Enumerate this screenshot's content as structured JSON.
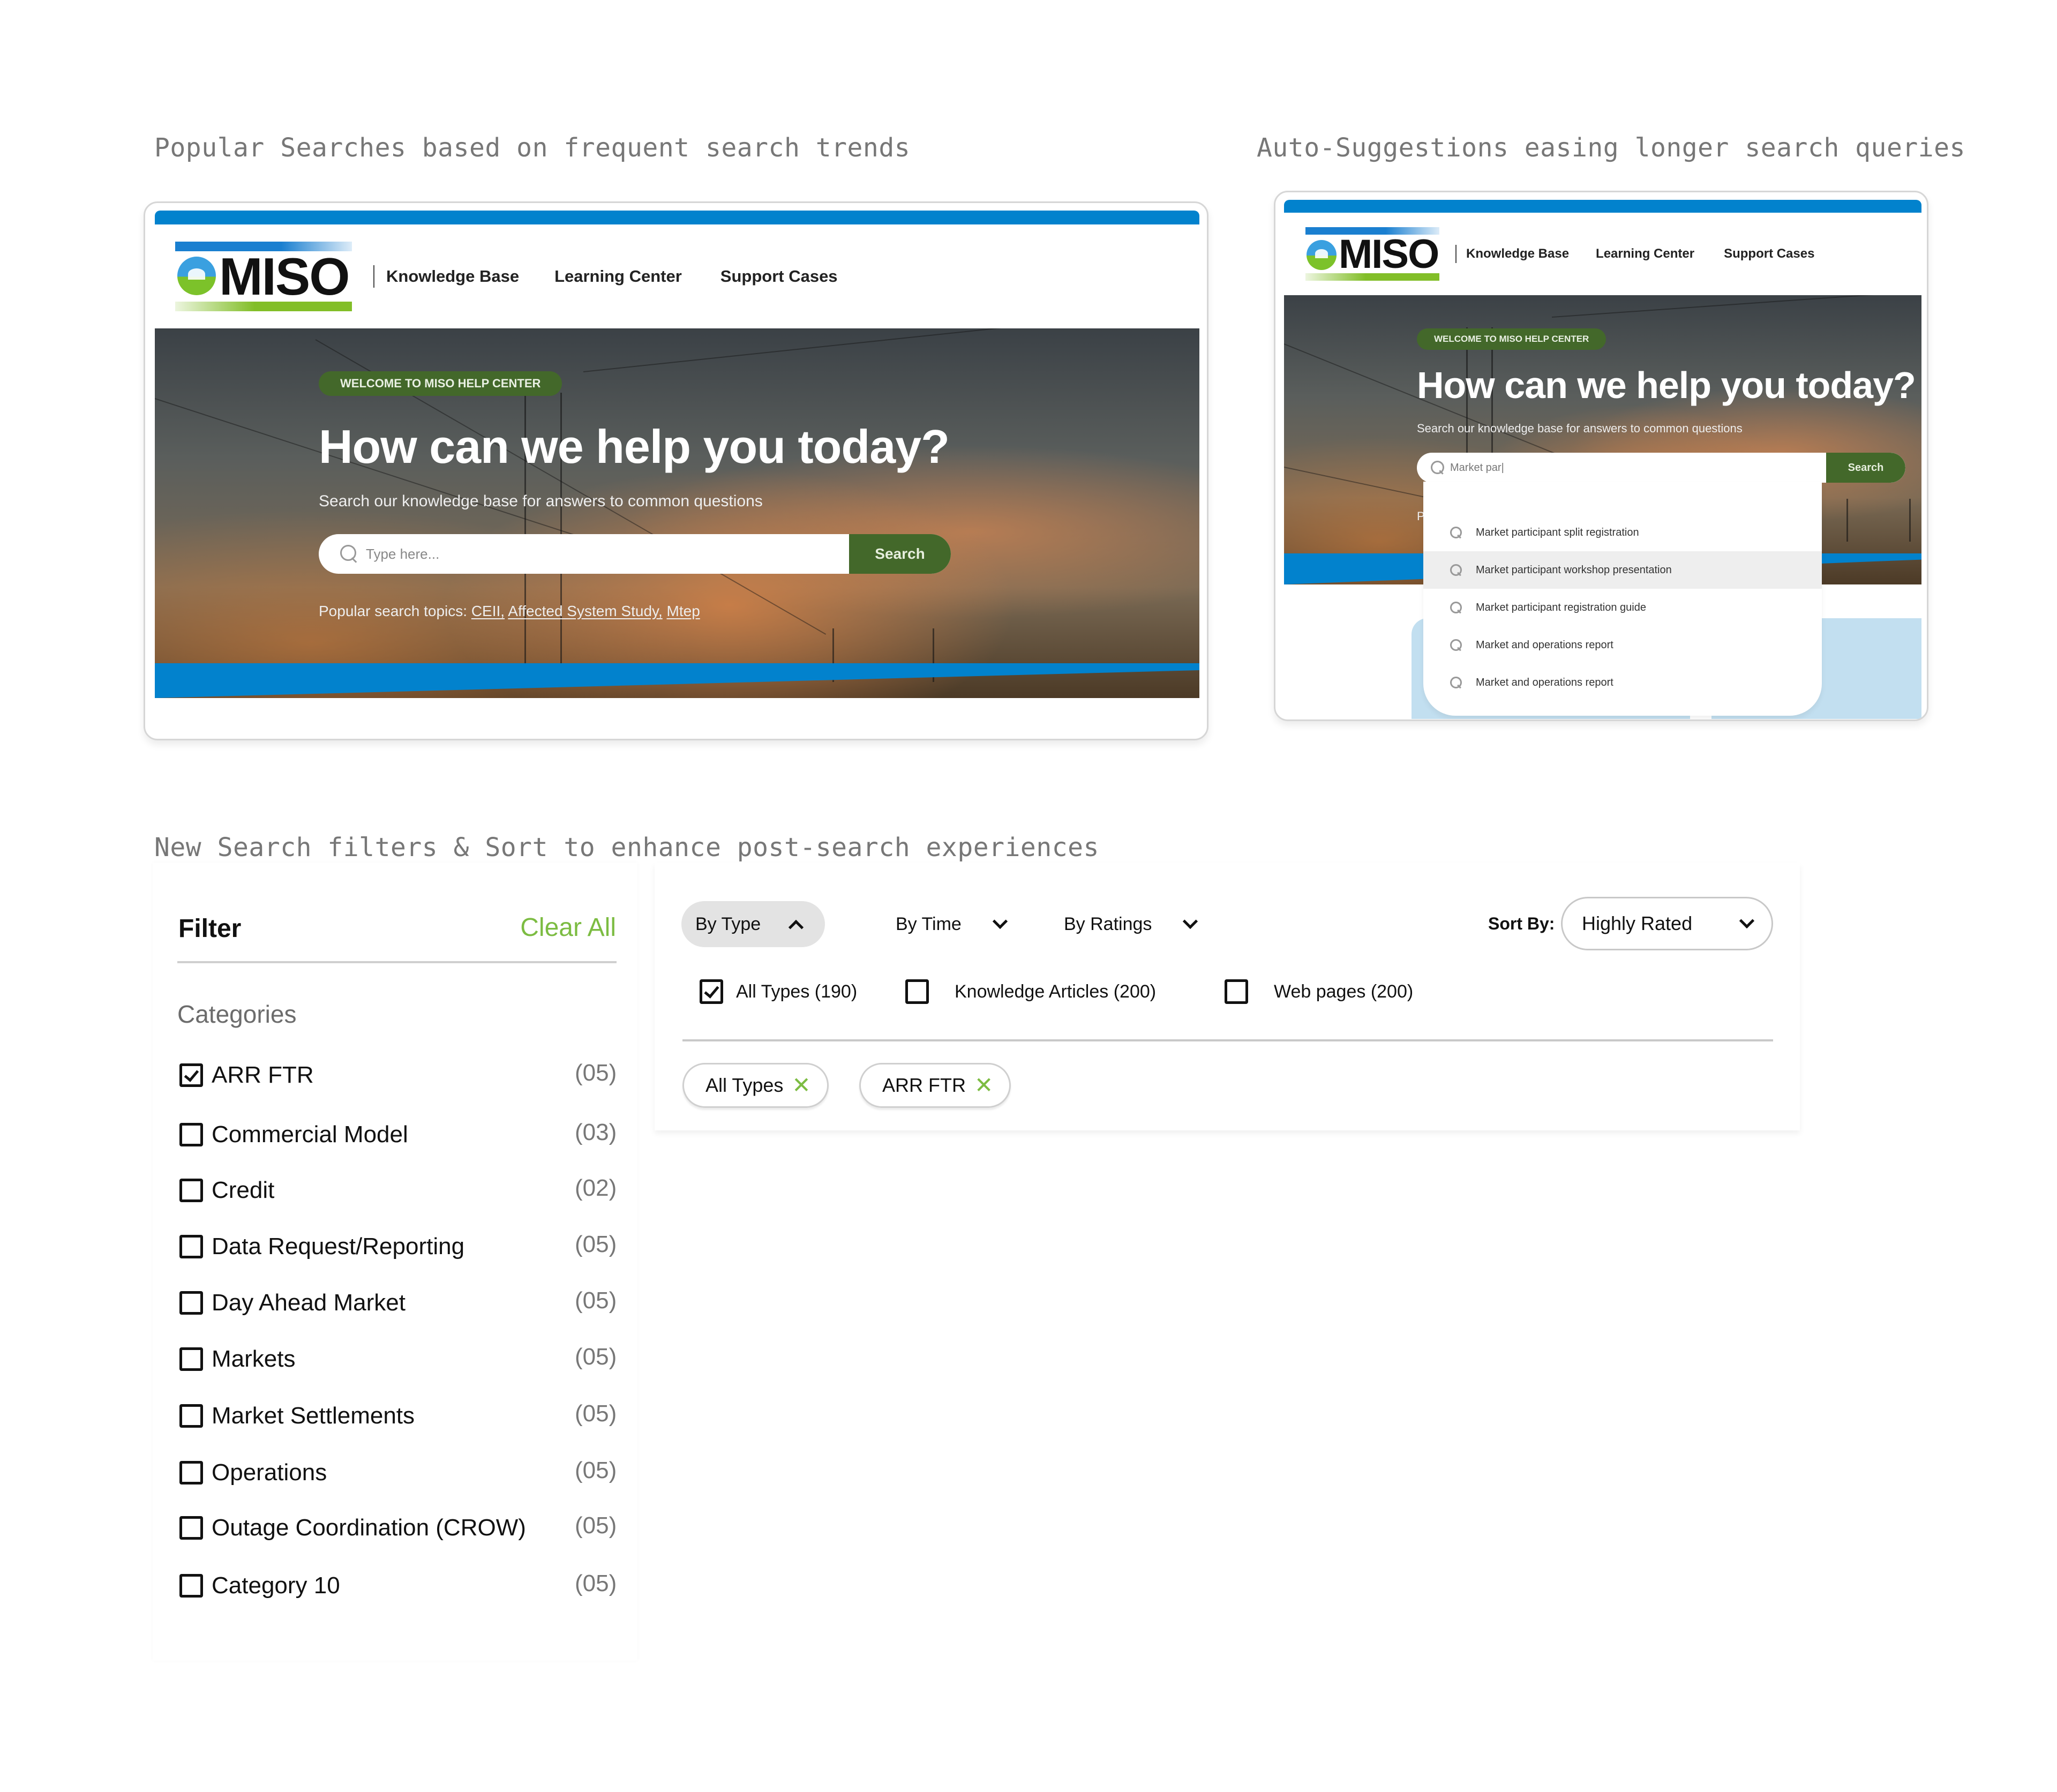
{
  "captions": {
    "popular": "Popular Searches based on frequent search trends",
    "autosuggest": "Auto-Suggestions easing longer search queries",
    "filters": "New Search filters & Sort to enhance post-search experiences"
  },
  "brand": {
    "logo_text": "MISO",
    "primary_blue": "#0282cd",
    "brand_green": "#43682a",
    "accent_green": "#7cbc42"
  },
  "nav": {
    "items": [
      "Knowledge Base",
      "Learning Center",
      "Support Cases"
    ]
  },
  "hero": {
    "welcome": "WELCOME TO MISO HELP CENTER",
    "title": "How can we help you today?",
    "subtitle": "Search our knowledge base for answers to common questions",
    "search_button": "Search"
  },
  "popular_card": {
    "search_placeholder": "Type here...",
    "popular_label": "Popular search topics:",
    "popular_topics": [
      "CEII,",
      "Affected System Study,",
      "Mtep"
    ]
  },
  "suggest_card": {
    "search_value": "Market par|",
    "popular_partial": "Po",
    "suggestions": [
      "Market participant split registration",
      "Market participant workshop presentation",
      "Market participant registration guide",
      "Market and operations report",
      "Market and operations report"
    ],
    "highlighted_index": 1
  },
  "filter": {
    "title": "Filter",
    "clear_all": "Clear All",
    "categories_label": "Categories",
    "categories": [
      {
        "label": "ARR FTR",
        "count": "(05)",
        "checked": true
      },
      {
        "label": "Commercial Model",
        "count": "(03)",
        "checked": false
      },
      {
        "label": "Credit",
        "count": "(02)",
        "checked": false
      },
      {
        "label": "Data Request/Reporting",
        "count": "(05)",
        "checked": false
      },
      {
        "label": "Day Ahead Market",
        "count": "(05)",
        "checked": false
      },
      {
        "label": "Markets",
        "count": "(05)",
        "checked": false
      },
      {
        "label": "Market Settlements",
        "count": "(05)",
        "checked": false
      },
      {
        "label": "Operations",
        "count": "(05)",
        "checked": false
      },
      {
        "label": "Outage Coordination (CROW)",
        "count": "(05)",
        "checked": false
      },
      {
        "label": "Category 10",
        "count": "(05)",
        "checked": false
      }
    ]
  },
  "results": {
    "tabs": [
      {
        "label": "By Type",
        "expanded": true
      },
      {
        "label": "By Time",
        "expanded": false
      },
      {
        "label": "By Ratings",
        "expanded": false
      }
    ],
    "sort_label": "Sort By:",
    "sort_value": "Highly Rated",
    "type_options": [
      {
        "label": "All Types (190)",
        "checked": true
      },
      {
        "label": "Knowledge Articles (200)",
        "checked": false
      },
      {
        "label": "Web pages (200)",
        "checked": false
      }
    ],
    "active_tags": [
      "All Types",
      "ARR FTR"
    ]
  }
}
